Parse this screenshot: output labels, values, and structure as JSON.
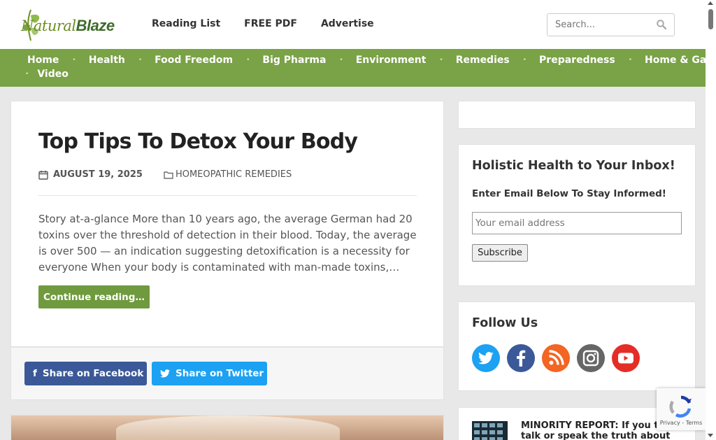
{
  "header": {
    "logo": {
      "part1": "Natural",
      "part2": "Blaze"
    },
    "top_links": [
      "Reading List",
      "FREE PDF",
      "Advertise"
    ],
    "search": {
      "placeholder": "Search...",
      "icon": "search-icon"
    }
  },
  "nav": {
    "row1": [
      "Home",
      "Health",
      "Food Freedom",
      "Big Pharma",
      "Environment",
      "Remedies",
      "Preparedness",
      "Home & Garden"
    ],
    "row2": [
      "Video"
    ],
    "separator": "•"
  },
  "post": {
    "title": "Top Tips To Detox Your Body",
    "date": "AUGUST 19, 2025",
    "category": "HOMEOPATHIC REMEDIES",
    "excerpt": "Story at-a-glance More than 10 years ago, the average German had 20 toxins over the threshold of detection in their blood. Today, the average is over 500 — an indication suggesting detoxification is a necessity for everyone When your body is contaminated with man-made toxins,…",
    "continue_label": "Continue reading…",
    "icons": {
      "date": "calendar-icon",
      "category": "folder-icon"
    }
  },
  "share": {
    "facebook": {
      "label": "Share on Facebook",
      "icon": "f",
      "color": "#3b5998"
    },
    "twitter": {
      "label": "Share on Twitter",
      "icon": "twitter-bird-icon",
      "color": "#1da1f2"
    }
  },
  "sidebar": {
    "newsletter": {
      "title": "Holistic Health to Your Inbox!",
      "subtitle": "Enter Email Below To Stay Informed!",
      "email_placeholder": "Your email address",
      "subscribe_label": "Subscribe"
    },
    "follow": {
      "title": "Follow Us",
      "icons": [
        "twitter-icon",
        "facebook-icon",
        "rss-icon",
        "instagram-icon",
        "youtube-icon"
      ]
    },
    "news_item": {
      "title": "MINORITY REPORT: If you think, talk or speak the truth about the"
    }
  },
  "recaptcha": {
    "legal": "Privacy - Terms"
  },
  "colors": {
    "nav": "#7aa246",
    "accent": "#6f9a3e",
    "facebook": "#3b5998",
    "twitter": "#1da1f2"
  }
}
